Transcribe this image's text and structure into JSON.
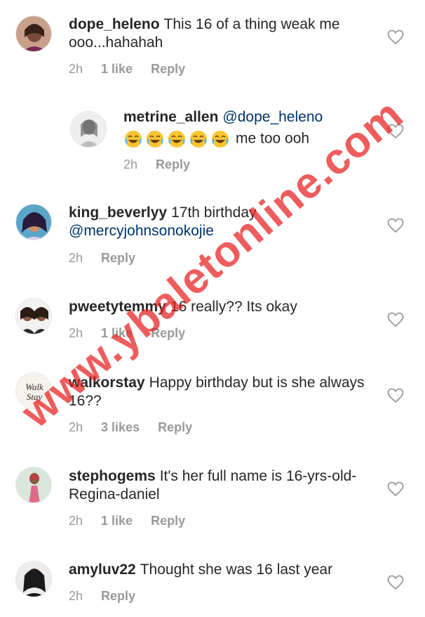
{
  "comments": [
    {
      "username": "dope_heleno",
      "text": "This 16 of a thing weak me ooo...hahahah",
      "time": "2h",
      "likes": "1 like",
      "reply": "Reply"
    },
    {
      "username": "metrine_allen",
      "mention": "@dope_heleno",
      "text": "me too ooh",
      "time": "2h",
      "reply": "Reply",
      "emoji_count": 5
    },
    {
      "username": "king_beverlyy",
      "text": "17th birthday",
      "mention": "@mercyjohnsonokojie",
      "time": "2h",
      "reply": "Reply"
    },
    {
      "username": "pweetytemmy",
      "text": "16 really?? Its okay",
      "time": "2h",
      "likes": "1 like",
      "reply": "Reply"
    },
    {
      "username": "walkorstay",
      "text": "Happy birthday but is she always 16??",
      "time": "2h",
      "likes": "3 likes",
      "reply": "Reply",
      "avatar_text": "Walk Stay"
    },
    {
      "username": "stephogems",
      "text": "It's her full name is 16-yrs-old-Regina-daniel",
      "time": "2h",
      "likes": "1 like",
      "reply": "Reply"
    },
    {
      "username": "amyluv22",
      "text": "Thought she was 16 last year",
      "time": "2h",
      "reply": "Reply"
    }
  ],
  "watermark": "www.ybaletonline.com",
  "colors": {
    "text": "#262626",
    "meta": "#999999",
    "mention": "#003569",
    "watermark": "#e81e1e"
  },
  "icons": {
    "like": "heart-outline-icon",
    "emoji": "face-with-tears-of-joy-icon"
  }
}
